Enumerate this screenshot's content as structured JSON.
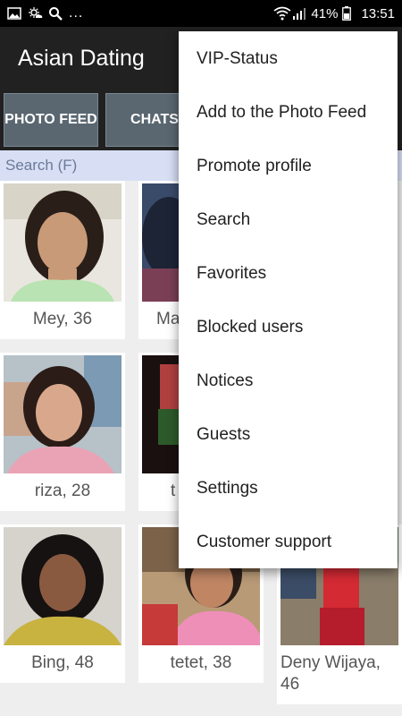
{
  "status_bar": {
    "battery": "41%",
    "time": "13:51",
    "ellipsis": "..."
  },
  "app_bar": {
    "title": "Asian Dating"
  },
  "tabs": [
    {
      "label": "PHOTO FEED"
    },
    {
      "label": "CHATS"
    }
  ],
  "search": {
    "label": "Search (F)"
  },
  "profiles": [
    {
      "caption": "Mey, 36"
    },
    {
      "caption": "Ma"
    },
    {
      "caption": "riza, 28"
    },
    {
      "caption": "t"
    },
    {
      "caption": "Bing, 48"
    },
    {
      "caption": "tetet, 38"
    },
    {
      "caption": "Deny Wijaya, 46"
    }
  ],
  "menu": {
    "items": [
      {
        "label": "VIP-Status"
      },
      {
        "label": "Add to the Photo Feed"
      },
      {
        "label": "Promote profile"
      },
      {
        "label": "Search"
      },
      {
        "label": "Favorites"
      },
      {
        "label": "Blocked users"
      },
      {
        "label": "Notices"
      },
      {
        "label": "Guests"
      },
      {
        "label": "Settings"
      },
      {
        "label": "Customer support"
      }
    ]
  },
  "colors": {
    "app_bar": "#212121",
    "tab_bg": "#5a6770",
    "search_bg": "#d8dff4",
    "menu_bg": "#ffffff"
  }
}
